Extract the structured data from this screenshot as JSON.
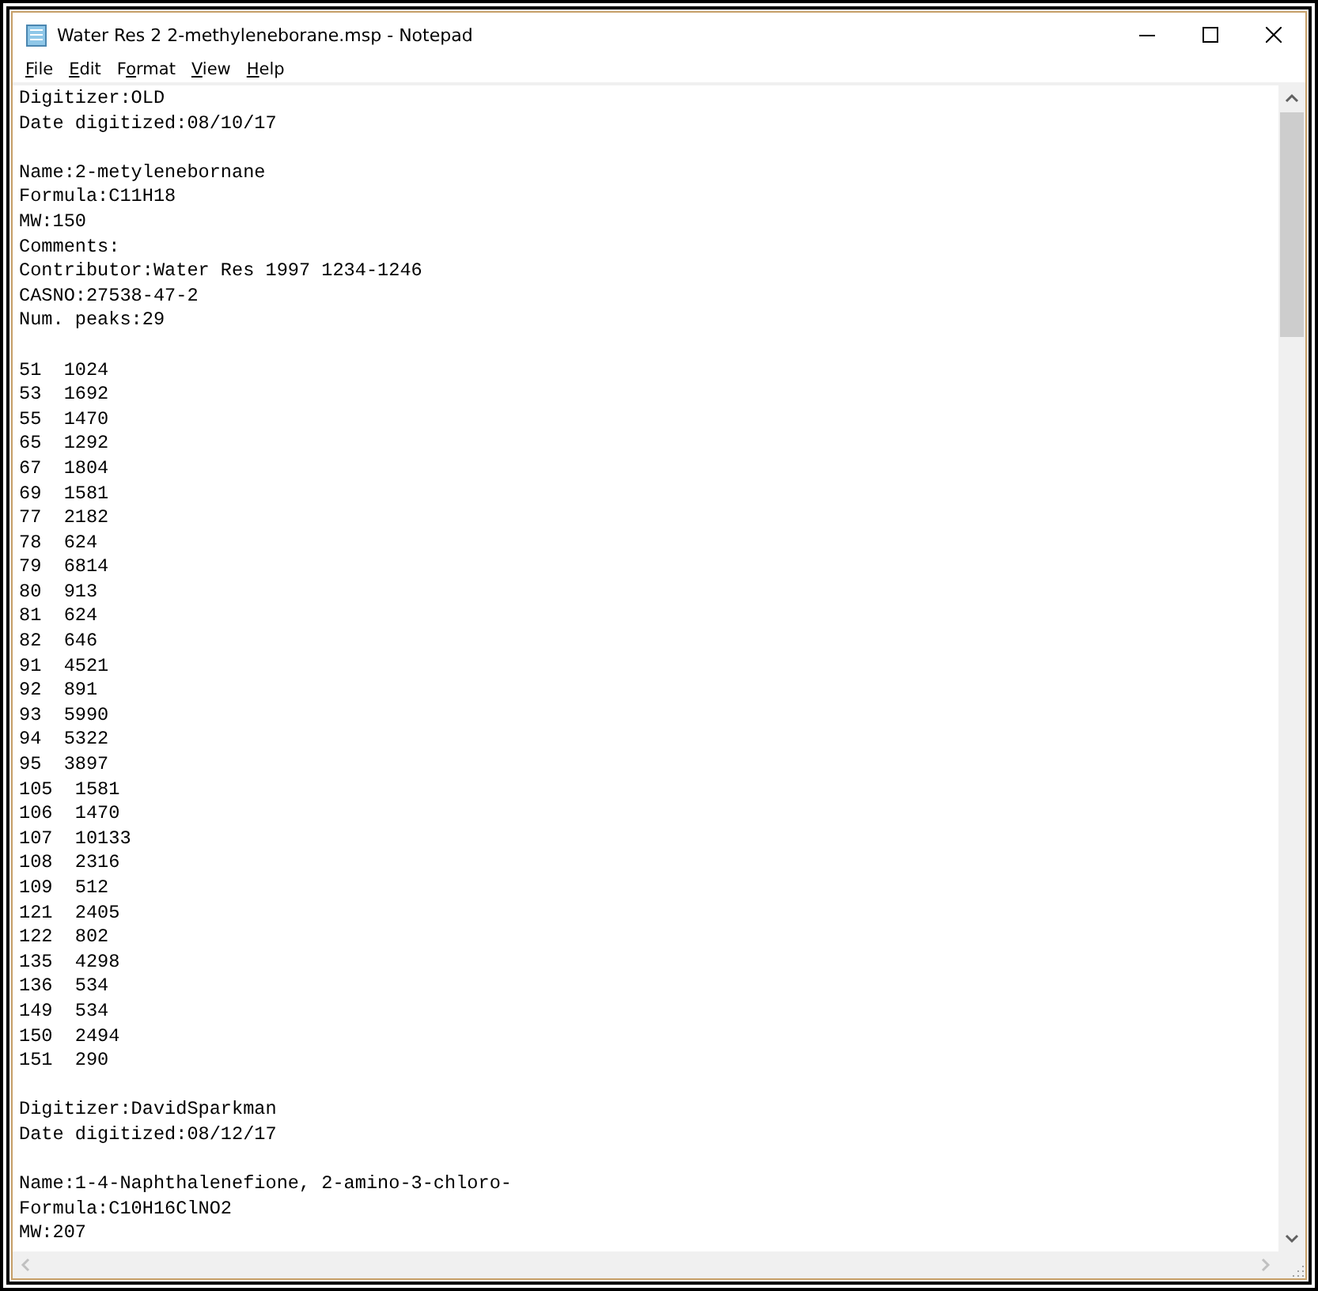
{
  "window": {
    "title": "Water Res 2  2-methyleneborane.msp - Notepad"
  },
  "menu": [
    {
      "access_key": "F",
      "after": "ile"
    },
    {
      "access_key": "E",
      "after": "dit"
    },
    {
      "before": "F",
      "access_key": "o",
      "after": "rmat"
    },
    {
      "access_key": "V",
      "after": "iew"
    },
    {
      "access_key": "H",
      "after": "elp"
    }
  ],
  "document": {
    "paragraphs": [
      [
        "Digitizer:OLD",
        "Date digitized:08/10/17"
      ],
      [
        "Name:2-metylenebornane",
        "Formula:C11H18",
        "MW:150",
        "Comments:",
        "Contributor:Water Res 1997 1234-1246",
        "CASNO:27538-47-2",
        "Num. peaks:29"
      ],
      [
        "51  1024",
        "53  1692",
        "55  1470",
        "65  1292",
        "67  1804",
        "69  1581",
        "77  2182",
        "78  624",
        "79  6814",
        "80  913",
        "81  624",
        "82  646",
        "91  4521",
        "92  891",
        "93  5990",
        "94  5322",
        "95  3897",
        "105  1581",
        "106  1470",
        "107  10133",
        "108  2316",
        "109  512",
        "121  2405",
        "122  802",
        "135  4298",
        "136  534",
        "149  534",
        "150  2494",
        "151  290"
      ],
      [
        "Digitizer:DavidSparkman",
        "Date digitized:08/12/17"
      ],
      [
        "Name:1-4-Naphthalenefione, 2-amino-3-chloro-",
        "Formula:C10H16ClNO2",
        "MW:207"
      ]
    ]
  }
}
